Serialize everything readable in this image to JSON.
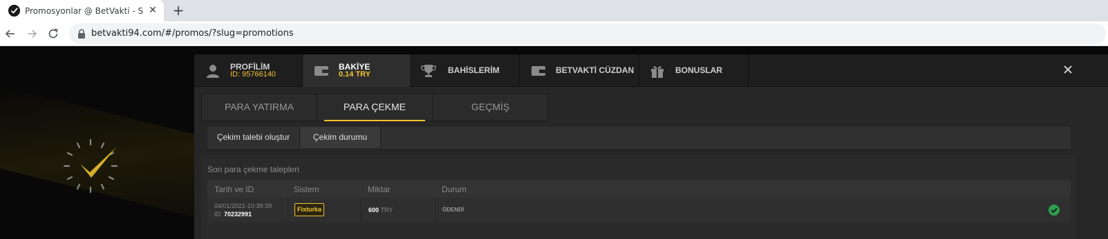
{
  "browser": {
    "tab_title": "Promosyonlar @ BetVakti - Spor",
    "tab_close": "✕",
    "new_tab": "+",
    "url": "betvakti94.com/#/promos/?slug=promotions"
  },
  "nav": {
    "items": [
      {
        "title": "PROFİLİM",
        "sub": "ID: 95766140",
        "icon": "user-icon"
      },
      {
        "title": "BAKİYE",
        "sub": "0.14 TRY",
        "icon": "wallet-icon"
      },
      {
        "title": "BAHİSLERİM",
        "icon": "trophy-icon"
      },
      {
        "title": "BETVAKTİ CÜZDAN",
        "icon": "wallet-icon"
      },
      {
        "title": "BONUSLAR",
        "icon": "gift-icon"
      }
    ],
    "active_index": 1
  },
  "tabs": {
    "items": [
      "PARA YATIRMA",
      "PARA ÇEKME",
      "GEÇMİŞ"
    ],
    "active_index": 1
  },
  "actions": {
    "items": [
      "Çekim talebi oluştur",
      "Çekim durumu"
    ],
    "active_index": 1
  },
  "history": {
    "title": "Son para çekme talepleri",
    "columns": [
      "Tarih ve ID",
      "Sistem",
      "Miktar",
      "Durum"
    ],
    "rows": [
      {
        "date": "04/01/2021-10:39:39",
        "id_label": "ID:",
        "id": "70232991",
        "system": "Fixturka",
        "amount": "600",
        "currency": "TRY",
        "status": "ÖDENDİ",
        "status_icon": "check-circle-icon"
      }
    ]
  },
  "colors": {
    "accent": "#f2c230",
    "success": "#2e9e4f"
  }
}
